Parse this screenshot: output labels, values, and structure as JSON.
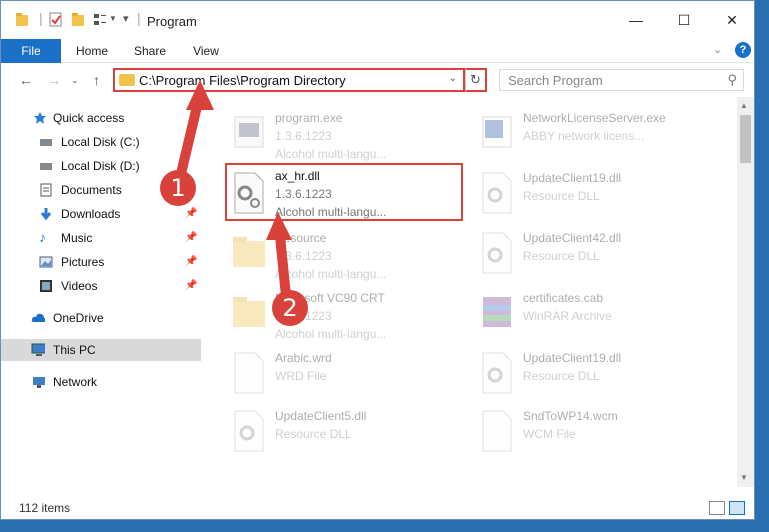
{
  "window": {
    "title": "Program"
  },
  "ribbon": {
    "file": "File",
    "home": "Home",
    "share": "Share",
    "view": "View"
  },
  "address": {
    "path": "C:\\Program Files\\Program Directory"
  },
  "search": {
    "placeholder": "Search Program"
  },
  "sidebar": {
    "quick_access": "Quick access",
    "local_c": "Local Disk (C:)",
    "local_d": "Local Disk (D:)",
    "documents": "Documents",
    "downloads": "Downloads",
    "music": "Music",
    "pictures": "Pictures",
    "videos": "Videos",
    "onedrive": "OneDrive",
    "thispc": "This PC",
    "network": "Network"
  },
  "files": {
    "f1": {
      "name": "program.exe",
      "version": "1.3.6.1223",
      "desc": "Alcohol multi-langu..."
    },
    "f2": {
      "name": "NetworkLicenseServer.exe",
      "version": "ABBY network licens..."
    },
    "f3": {
      "name": "ax_hr.dll",
      "version": "1.3.6.1223",
      "desc": "Alcohol multi-langu..."
    },
    "f4": {
      "name": "UpdateClient19.dll",
      "version": "Resource DLL"
    },
    "f5": {
      "name": "Resource",
      "version": "1.3.6.1223",
      "desc": "Alcohol multi-langu..."
    },
    "f6": {
      "name": "UpdateClient42.dll",
      "version": "Resource DLL"
    },
    "f7": {
      "name": "Microsoft VC90 CRT",
      "version": "1.3.6.1223",
      "desc": "Alcohol multi-langu..."
    },
    "f8": {
      "name": "certificates.cab",
      "version": "WinRAR Archive"
    },
    "f9": {
      "name": "Arabic.wrd",
      "version": "WRD File"
    },
    "f10": {
      "name": "UpdateClient19.dll",
      "version": "Resource DLL"
    },
    "f11": {
      "name": "UpdateClient5.dll",
      "version": "Resource DLL"
    },
    "f12": {
      "name": "SndToWP14.wcm",
      "version": "WCM File"
    }
  },
  "status": {
    "items": "112 items"
  },
  "annotations": {
    "step1": "1",
    "step2": "2"
  },
  "colors": {
    "accent": "#1a6fc7",
    "highlight": "#d9413b",
    "folder": "#f3c24a"
  }
}
